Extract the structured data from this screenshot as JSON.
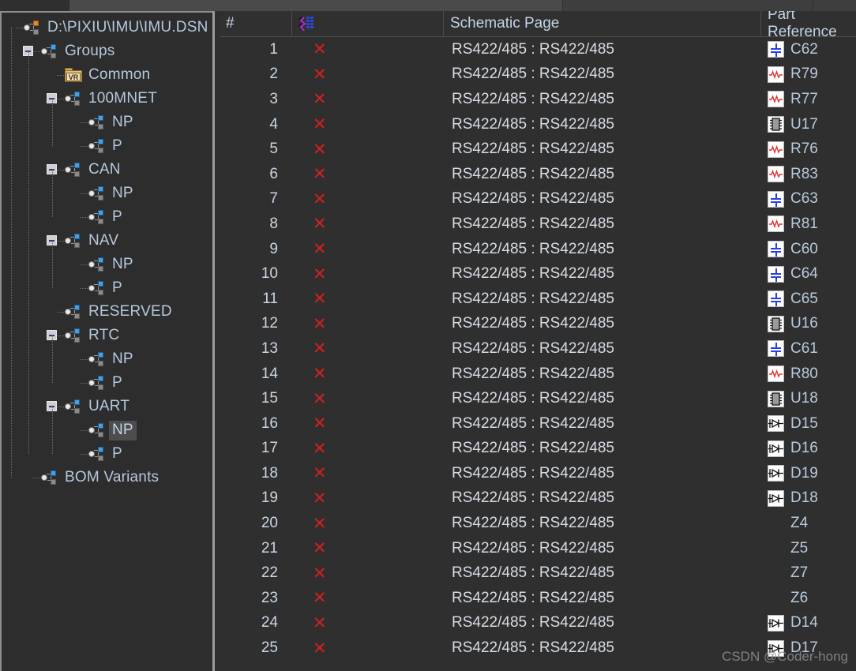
{
  "window": {
    "tabs": [
      "",
      "",
      "",
      ""
    ]
  },
  "sidebar": {
    "items": [
      {
        "label": "D:\\PIXIU\\IMU\\IMU.DSN",
        "depth": 0,
        "icon": "group-icon-root",
        "expander": "none",
        "selected": false
      },
      {
        "label": "Groups",
        "depth": 1,
        "icon": "group-icon",
        "expander": "minus",
        "selected": false
      },
      {
        "label": "Common",
        "depth": 2,
        "icon": "vr-folder-icon",
        "expander": "none",
        "selected": false
      },
      {
        "label": "100MNET",
        "depth": 2,
        "icon": "group-icon",
        "expander": "minus",
        "selected": false
      },
      {
        "label": "NP",
        "depth": 3,
        "icon": "group-icon",
        "expander": "none",
        "selected": false
      },
      {
        "label": "P",
        "depth": 3,
        "icon": "group-icon",
        "expander": "none",
        "selected": false
      },
      {
        "label": "CAN",
        "depth": 2,
        "icon": "group-icon",
        "expander": "minus",
        "selected": false
      },
      {
        "label": "NP",
        "depth": 3,
        "icon": "group-icon",
        "expander": "none",
        "selected": false
      },
      {
        "label": "P",
        "depth": 3,
        "icon": "group-icon",
        "expander": "none",
        "selected": false
      },
      {
        "label": "NAV",
        "depth": 2,
        "icon": "group-icon",
        "expander": "minus",
        "selected": false
      },
      {
        "label": "NP",
        "depth": 3,
        "icon": "group-icon",
        "expander": "none",
        "selected": false
      },
      {
        "label": "P",
        "depth": 3,
        "icon": "group-icon",
        "expander": "none",
        "selected": false
      },
      {
        "label": "RESERVED",
        "depth": 2,
        "icon": "group-icon",
        "expander": "none",
        "selected": false
      },
      {
        "label": "RTC",
        "depth": 2,
        "icon": "group-icon",
        "expander": "minus",
        "selected": false
      },
      {
        "label": "NP",
        "depth": 3,
        "icon": "group-icon",
        "expander": "none",
        "selected": false
      },
      {
        "label": "P",
        "depth": 3,
        "icon": "group-icon",
        "expander": "none",
        "selected": false
      },
      {
        "label": "UART",
        "depth": 2,
        "icon": "group-icon",
        "expander": "minus",
        "selected": false
      },
      {
        "label": "NP",
        "depth": 3,
        "icon": "group-icon",
        "expander": "none",
        "selected": true
      },
      {
        "label": "P",
        "depth": 3,
        "icon": "group-icon",
        "expander": "none",
        "selected": false
      },
      {
        "label": "BOM Variants",
        "depth": 1,
        "icon": "group-icon",
        "expander": "none",
        "selected": false
      }
    ]
  },
  "table": {
    "columns": [
      {
        "key": "num",
        "label": "#",
        "icon": null
      },
      {
        "key": "drc",
        "label": "",
        "icon": "drc-marker-icon"
      },
      {
        "key": "page",
        "label": "Schematic Page",
        "icon": null
      },
      {
        "key": "part",
        "label": "Part Reference",
        "icon": null
      }
    ],
    "rows": [
      {
        "num": "1",
        "drc": "✕",
        "page": "RS422/485 : RS422/485",
        "part": "C62",
        "part_icon": "capacitor-icon"
      },
      {
        "num": "2",
        "drc": "✕",
        "page": "RS422/485 : RS422/485",
        "part": "R79",
        "part_icon": "resistor-icon"
      },
      {
        "num": "3",
        "drc": "✕",
        "page": "RS422/485 : RS422/485",
        "part": "R77",
        "part_icon": "resistor-icon"
      },
      {
        "num": "4",
        "drc": "✕",
        "page": "RS422/485 : RS422/485",
        "part": "U17",
        "part_icon": "ic-icon"
      },
      {
        "num": "5",
        "drc": "✕",
        "page": "RS422/485 : RS422/485",
        "part": "R76",
        "part_icon": "resistor-icon"
      },
      {
        "num": "6",
        "drc": "✕",
        "page": "RS422/485 : RS422/485",
        "part": "R83",
        "part_icon": "resistor-icon"
      },
      {
        "num": "7",
        "drc": "✕",
        "page": "RS422/485 : RS422/485",
        "part": "C63",
        "part_icon": "capacitor-icon"
      },
      {
        "num": "8",
        "drc": "✕",
        "page": "RS422/485 : RS422/485",
        "part": "R81",
        "part_icon": "resistor-icon"
      },
      {
        "num": "9",
        "drc": "✕",
        "page": "RS422/485 : RS422/485",
        "part": "C60",
        "part_icon": "capacitor-icon"
      },
      {
        "num": "10",
        "drc": "✕",
        "page": "RS422/485 : RS422/485",
        "part": "C64",
        "part_icon": "capacitor-icon"
      },
      {
        "num": "11",
        "drc": "✕",
        "page": "RS422/485 : RS422/485",
        "part": "C65",
        "part_icon": "capacitor-icon"
      },
      {
        "num": "12",
        "drc": "✕",
        "page": "RS422/485 : RS422/485",
        "part": "U16",
        "part_icon": "ic-icon"
      },
      {
        "num": "13",
        "drc": "✕",
        "page": "RS422/485 : RS422/485",
        "part": "C61",
        "part_icon": "capacitor-icon"
      },
      {
        "num": "14",
        "drc": "✕",
        "page": "RS422/485 : RS422/485",
        "part": "R80",
        "part_icon": "resistor-icon"
      },
      {
        "num": "15",
        "drc": "✕",
        "page": "RS422/485 : RS422/485",
        "part": "U18",
        "part_icon": "ic-icon"
      },
      {
        "num": "16",
        "drc": "✕",
        "page": "RS422/485 : RS422/485",
        "part": "D15",
        "part_icon": "diode-icon"
      },
      {
        "num": "17",
        "drc": "✕",
        "page": "RS422/485 : RS422/485",
        "part": "D16",
        "part_icon": "diode-icon"
      },
      {
        "num": "18",
        "drc": "✕",
        "page": "RS422/485 : RS422/485",
        "part": "D19",
        "part_icon": "diode-icon"
      },
      {
        "num": "19",
        "drc": "✕",
        "page": "RS422/485 : RS422/485",
        "part": "D18",
        "part_icon": "diode-icon"
      },
      {
        "num": "20",
        "drc": "✕",
        "page": "RS422/485 : RS422/485",
        "part": "Z4",
        "part_icon": null
      },
      {
        "num": "21",
        "drc": "✕",
        "page": "RS422/485 : RS422/485",
        "part": "Z5",
        "part_icon": null
      },
      {
        "num": "22",
        "drc": "✕",
        "page": "RS422/485 : RS422/485",
        "part": "Z7",
        "part_icon": null
      },
      {
        "num": "23",
        "drc": "✕",
        "page": "RS422/485 : RS422/485",
        "part": "Z6",
        "part_icon": null
      },
      {
        "num": "24",
        "drc": "✕",
        "page": "RS422/485 : RS422/485",
        "part": "D14",
        "part_icon": "diode-icon"
      },
      {
        "num": "25",
        "drc": "✕",
        "page": "RS422/485 : RS422/485",
        "part": "D17",
        "part_icon": "diode-icon"
      }
    ]
  },
  "watermark": {
    "text": "CSDN @Coder-hong"
  },
  "colors": {
    "background": "#2f2f2f",
    "panel": "#2d2d2d",
    "text": "#c3d4e7",
    "drc_error": "#d42020",
    "selection": "#4d4d4d",
    "capacitor_blue": "#2b3fe0",
    "resistor_red": "#d42020",
    "root_badge_orange": "#e08a2e",
    "node_badge_blue": "#4a9fe0"
  }
}
